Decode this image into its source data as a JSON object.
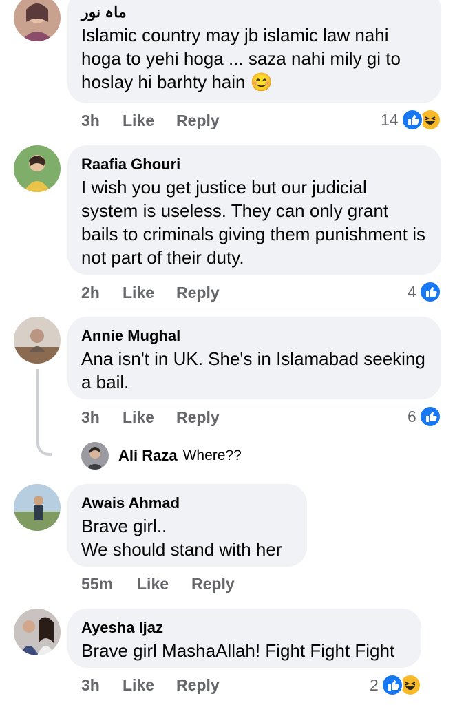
{
  "comments": [
    {
      "author": "ماہ نور",
      "text": "Islamic country may jb islamic law nahi hoga to yehi hoga ... saza nahi mily gi to hoslay hi barhty hain 😊",
      "time": "3h",
      "like_label": "Like",
      "reply_label": "Reply",
      "reaction_count": "14",
      "reactions": [
        "like-icon",
        "haha-icon"
      ]
    },
    {
      "author": "Raafia Ghouri",
      "text": "I wish you get justice but our judicial system is useless. They can only grant bails to criminals giving them punishment is not part of their duty.",
      "time": "2h",
      "like_label": "Like",
      "reply_label": "Reply",
      "reaction_count": "4",
      "reactions": [
        "like-icon"
      ]
    },
    {
      "author": "Annie Mughal",
      "text": "Ana isn't in UK. She's in Islamabad seeking a bail.",
      "time": "3h",
      "like_label": "Like",
      "reply_label": "Reply",
      "reaction_count": "6",
      "reactions": [
        "like-icon"
      ],
      "reply": {
        "author": "Ali Raza",
        "text": "Where??"
      }
    },
    {
      "author": "Awais Ahmad",
      "text": "Brave girl..\nWe should stand with her",
      "time": "55m",
      "like_label": "Like",
      "reply_label": "Reply"
    },
    {
      "author": "Ayesha Ijaz",
      "text": "Brave girl MashaAllah! Fight Fight Fight",
      "time": "3h",
      "like_label": "Like",
      "reply_label": "Reply",
      "reaction_count": "2",
      "reactions": [
        "like-icon",
        "haha-icon"
      ]
    }
  ],
  "colors": {
    "bubble": "#f0f2f5",
    "meta": "#65676b",
    "like": "#1877f2",
    "haha": "#f7b928"
  }
}
